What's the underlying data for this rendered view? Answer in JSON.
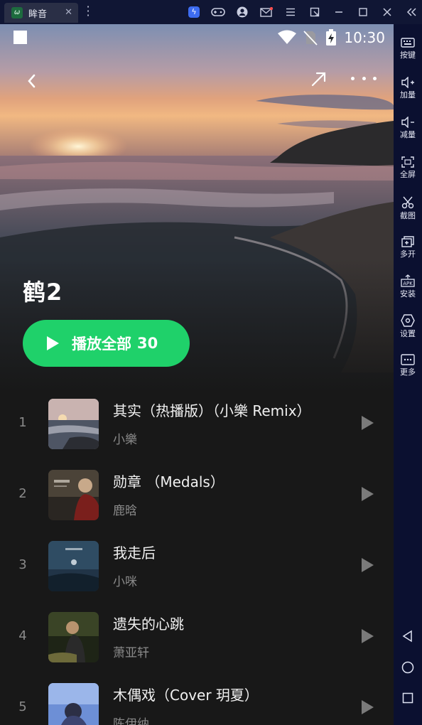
{
  "window": {
    "tab_title": "眸音",
    "tab_logo": "ω"
  },
  "emulator_sidebar": {
    "items": [
      {
        "label": "按键",
        "icon": "keyboard-icon"
      },
      {
        "label": "加量",
        "icon": "volume-up-icon"
      },
      {
        "label": "减量",
        "icon": "volume-down-icon"
      },
      {
        "label": "全屏",
        "icon": "fullscreen-icon"
      },
      {
        "label": "截图",
        "icon": "scissors-icon"
      },
      {
        "label": "多开",
        "icon": "multi-instance-icon"
      },
      {
        "label": "安装",
        "icon": "apk-install-icon"
      },
      {
        "label": "设置",
        "icon": "settings-icon"
      },
      {
        "label": "更多",
        "icon": "more-icon"
      }
    ]
  },
  "status_bar": {
    "time": "10:30"
  },
  "playlist": {
    "title": "鹤2",
    "play_all_label": "播放全部",
    "count": "30"
  },
  "songs": [
    {
      "index": "1",
      "title": "其实（热播版）（小樂 Remix）",
      "artist": "小樂"
    },
    {
      "index": "2",
      "title": "勋章 （Medals）",
      "artist": "鹿晗"
    },
    {
      "index": "3",
      "title": "我走后",
      "artist": "小咪"
    },
    {
      "index": "4",
      "title": "遗失的心跳",
      "artist": "萧亚轩"
    },
    {
      "index": "5",
      "title": "木偶戏（Cover 玥夏）",
      "artist": "陈伊纳"
    }
  ],
  "colors": {
    "accent_green": "#1fd16a",
    "list_background": "#181818",
    "emulator_chrome": "#0b1030"
  }
}
